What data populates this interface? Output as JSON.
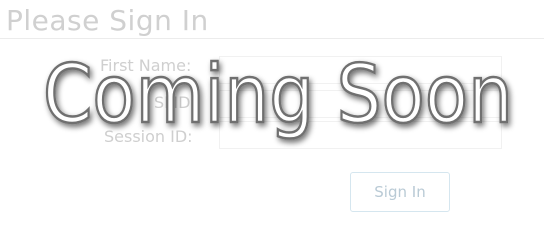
{
  "form": {
    "title": "Please Sign In",
    "fields": {
      "first_name": {
        "label": "First Name:",
        "value": ""
      },
      "sfid": {
        "label": "SFID:",
        "value": ""
      },
      "session_id": {
        "label": "Session ID:",
        "value": ""
      }
    },
    "submit_label": "Sign In"
  },
  "overlay": {
    "text": "Coming Soon"
  },
  "colors": {
    "title": "#d0d0d0",
    "labels": "#cfcfcf",
    "button_border": "#d5e6ef",
    "button_text": "#b9cad5",
    "overlay_fill": "#ffffff",
    "overlay_stroke": "#6f6f6f"
  }
}
